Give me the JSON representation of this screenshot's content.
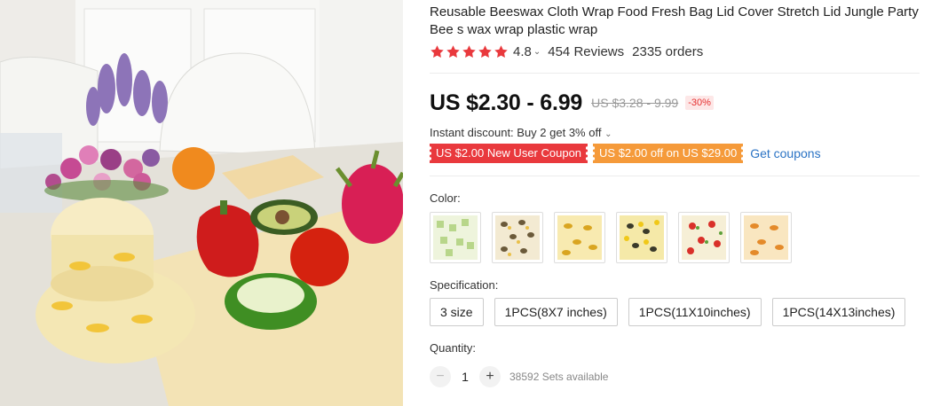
{
  "product": {
    "title": "Reusable Beeswax Cloth Wrap Food Fresh Bag Lid Cover Stretch Lid Jungle Party Bee s wax wrap plastic wrap",
    "rating": "4.8",
    "reviews": "454 Reviews",
    "orders": "2335 orders",
    "star_color": "#e9393d"
  },
  "price": {
    "current": "US $2.30 - 6.99",
    "original": "US $3.28 - 9.99",
    "discount": "-30%"
  },
  "promotions": {
    "instant_discount": "Instant discount: Buy 2 get 3% off",
    "coupon_new_user": "US $2.00 New User Coupon",
    "coupon_store": "US $2.00 off on US $29.00",
    "get_coupons": "Get coupons",
    "link_color": "#2a73c4"
  },
  "color": {
    "label": "Color:",
    "options": [
      "green-pattern",
      "bee-pattern",
      "bee-yellow-pattern",
      "honeycomb-pattern",
      "cherry-pattern",
      "orange-bee-pattern"
    ]
  },
  "specification": {
    "label": "Specification:",
    "options": [
      "3 size",
      "1PCS(8X7 inches)",
      "1PCS(11X10inches)",
      "1PCS(14X13inches)"
    ]
  },
  "quantity": {
    "label": "Quantity:",
    "minus": "−",
    "value": "1",
    "plus": "+",
    "available": "38592 Sets available"
  }
}
